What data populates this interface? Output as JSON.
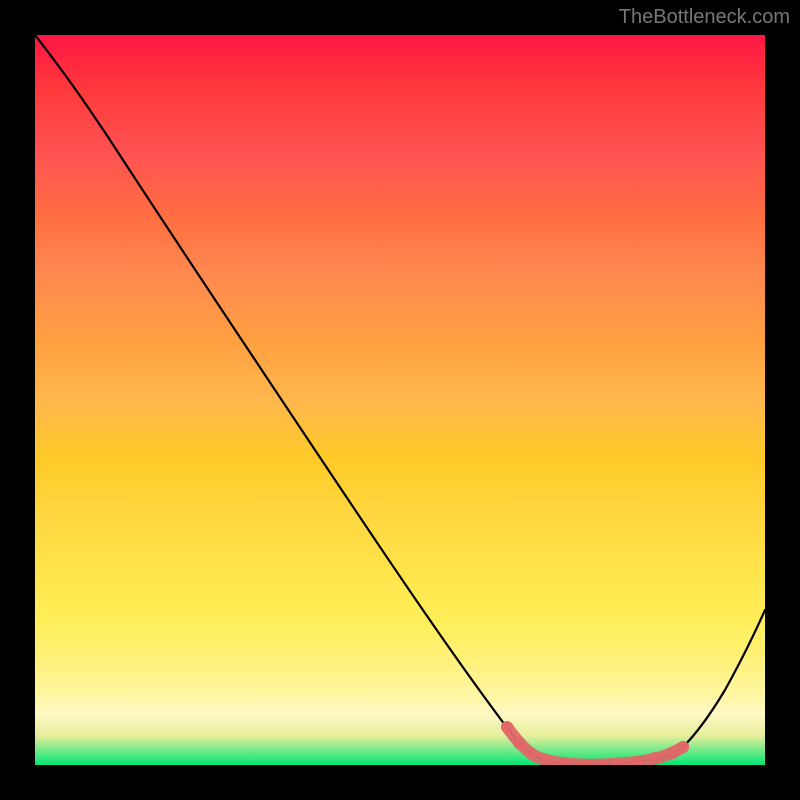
{
  "watermark": "TheBottleneck.com",
  "chart_data": {
    "type": "line",
    "title": "",
    "xlabel": "",
    "ylabel": "",
    "xlim": [
      0,
      100
    ],
    "ylim": [
      0,
      100
    ],
    "grid": false,
    "note": "No axes, ticks, or numeric labels are rendered in the image; values below are pixel-traced estimates.",
    "series": [
      {
        "name": "bottleneck-curve",
        "color": "#000000",
        "x": [
          0,
          5,
          10,
          15,
          20,
          25,
          30,
          35,
          40,
          45,
          50,
          55,
          60,
          65,
          68,
          70,
          72,
          74,
          76,
          78,
          80,
          82,
          84,
          86,
          88,
          90,
          92,
          95,
          100
        ],
        "y": [
          100,
          95,
          89,
          82,
          75,
          68,
          61,
          54,
          47,
          40,
          33,
          26,
          19,
          12,
          8,
          5,
          3,
          1.5,
          0.7,
          0.3,
          0.2,
          0.2,
          0.4,
          1.0,
          2.5,
          5,
          9,
          15,
          27
        ]
      },
      {
        "name": "marker-band",
        "color": "#e57373",
        "x": [
          68,
          70,
          72,
          74,
          76,
          78,
          80,
          82,
          84,
          86,
          88
        ],
        "y": [
          8,
          5,
          3,
          1.5,
          0.7,
          0.3,
          0.2,
          0.2,
          0.4,
          1.0,
          2.5
        ]
      }
    ]
  }
}
